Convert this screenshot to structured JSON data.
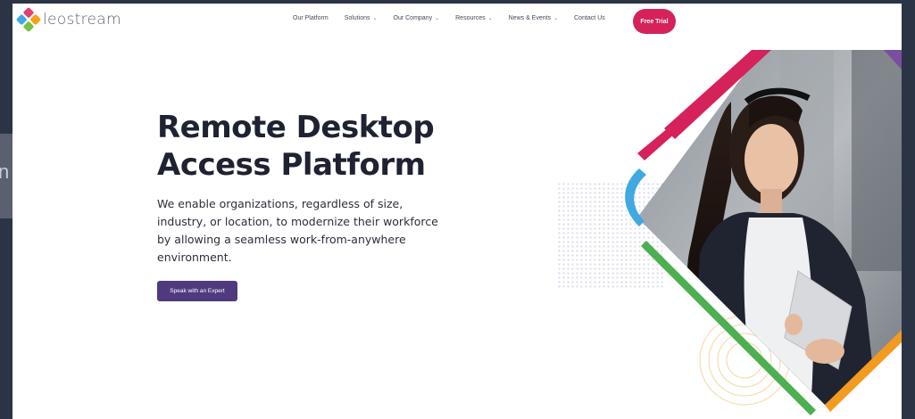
{
  "header": {
    "logo_text": "leostream",
    "nav": [
      {
        "label": "Our Platform",
        "has_dropdown": false
      },
      {
        "label": "Solutions",
        "has_dropdown": true
      },
      {
        "label": "Our Company",
        "has_dropdown": true
      },
      {
        "label": "Resources",
        "has_dropdown": true
      },
      {
        "label": "News & Events",
        "has_dropdown": true
      },
      {
        "label": "Contact Us",
        "has_dropdown": false
      }
    ],
    "cta_label": "Free Trial"
  },
  "hero": {
    "title_line1": "Remote Desktop",
    "title_line2": "Access Platform",
    "body": "We enable organizations, regardless of size, industry, or location, to modernize their workforce by allowing a seamless work-from-anywhere environment.",
    "button_label": "Speak with an Expert"
  },
  "colors": {
    "brand_pink": "#d6225a",
    "brand_purple": "#4f3a80",
    "accent_blue": "#3fa9e0",
    "accent_orange": "#f39a21",
    "accent_green": "#4caf50"
  },
  "icons": {
    "logo": "leostream-diamond-icon",
    "dropdown": "chevron-down-icon"
  }
}
